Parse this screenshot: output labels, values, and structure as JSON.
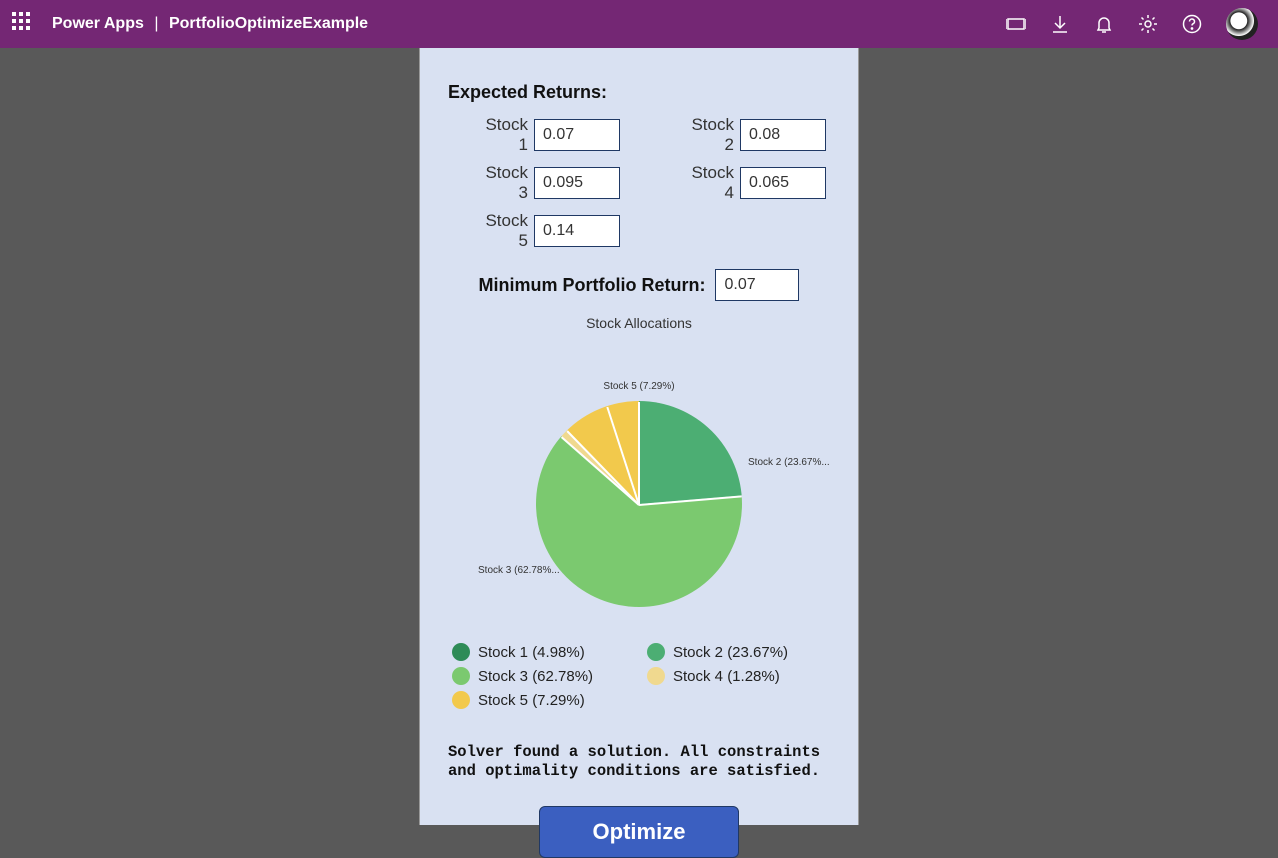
{
  "header": {
    "app_name": "Power Apps",
    "file_name": "PortfolioOptimizeExample"
  },
  "labels": {
    "expected_returns": "Expected Returns:",
    "min_return": "Minimum Portfolio Return:",
    "chart_title": "Stock Allocations",
    "optimize": "Optimize"
  },
  "stocks": {
    "s1": {
      "label": "Stock 1",
      "value": "0.07"
    },
    "s2": {
      "label": "Stock 2",
      "value": "0.08"
    },
    "s3": {
      "label": "Stock 3",
      "value": "0.095"
    },
    "s4": {
      "label": "Stock 4",
      "value": "0.065"
    },
    "s5": {
      "label": "Stock 5",
      "value": "0.14"
    }
  },
  "min_return_value": "0.07",
  "status": "Solver found a solution. All constraints and optimality conditions are satisfied.",
  "callouts": {
    "s2": "Stock 2 (23.67%...",
    "s3": "Stock 3 (62.78%...",
    "s5": "Stock 5 (7.29%)"
  },
  "legend": {
    "s1": "Stock 1 (4.98%)",
    "s2": "Stock 2 (23.67%)",
    "s3": "Stock 3 (62.78%)",
    "s4": "Stock 4 (1.28%)",
    "s5": "Stock 5 (7.29%)"
  },
  "colors": {
    "s1": "#2e8b57",
    "s2": "#4cae73",
    "s3": "#7bc96f",
    "s4": "#f0d98f",
    "s5": "#f2c94c"
  },
  "chart_data": {
    "type": "pie",
    "title": "Stock Allocations",
    "series": [
      {
        "name": "Stock 1",
        "value": 4.98,
        "color": "#2e8b57"
      },
      {
        "name": "Stock 2",
        "value": 23.67,
        "color": "#4cae73"
      },
      {
        "name": "Stock 3",
        "value": 62.78,
        "color": "#7bc96f"
      },
      {
        "name": "Stock 4",
        "value": 1.28,
        "color": "#f0d98f"
      },
      {
        "name": "Stock 5",
        "value": 7.29,
        "color": "#f2c94c"
      }
    ]
  }
}
